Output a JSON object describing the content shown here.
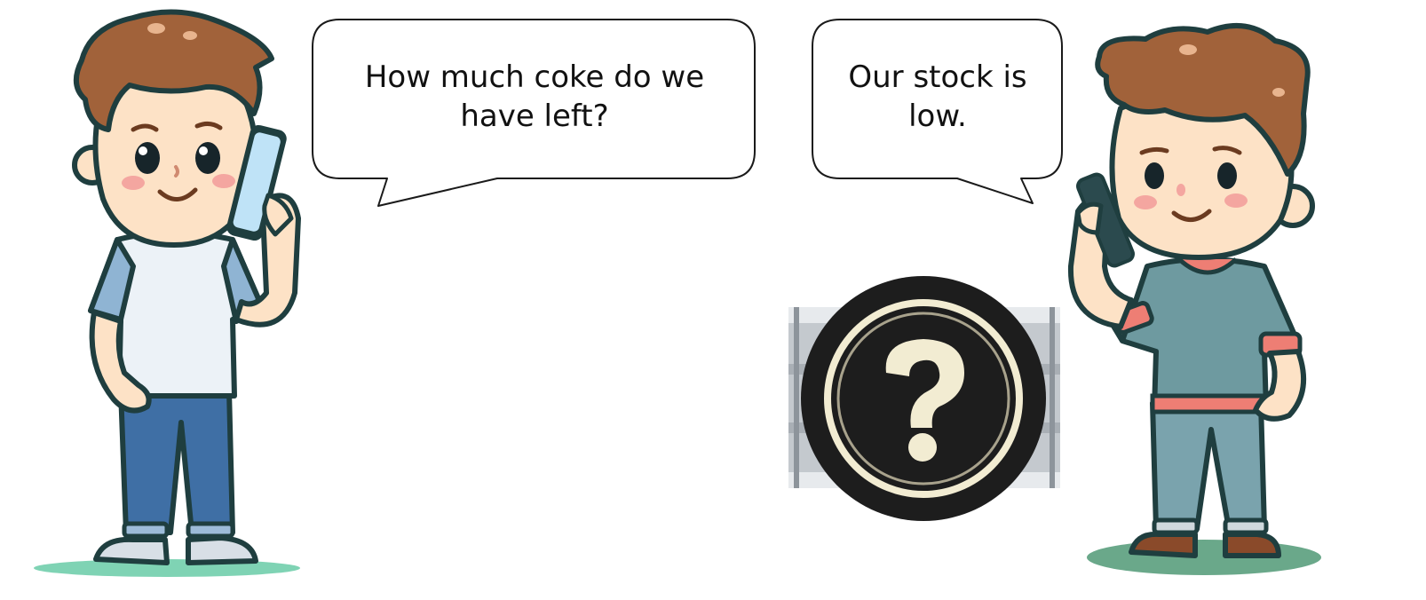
{
  "conversation": {
    "left_speech": {
      "line_1": "How much coke do we",
      "line_2": "have left?"
    },
    "right_speech": {
      "line_1": "Our stock is",
      "line_2": "low."
    }
  },
  "stock_status_badge": {
    "icon": "question-mark-icon",
    "colors": {
      "badge": "#1d1d1d",
      "mark": "#f2ecd2",
      "shelf": "#c4c9ce"
    }
  },
  "colors": {
    "outline": "#1f3e3f",
    "skin": "#fde2c6",
    "hair": "#a1623a",
    "left_shirt": "#ecf2f7",
    "left_sleeves": "#8fb4d3",
    "left_jeans": "#3f6fa5",
    "right_shirt": "#6e9aa0",
    "right_accent": "#ee7e74",
    "right_pants": "#7aa3ad",
    "ground_left": "#7fd3b4",
    "ground_right": "#6aa88a"
  }
}
